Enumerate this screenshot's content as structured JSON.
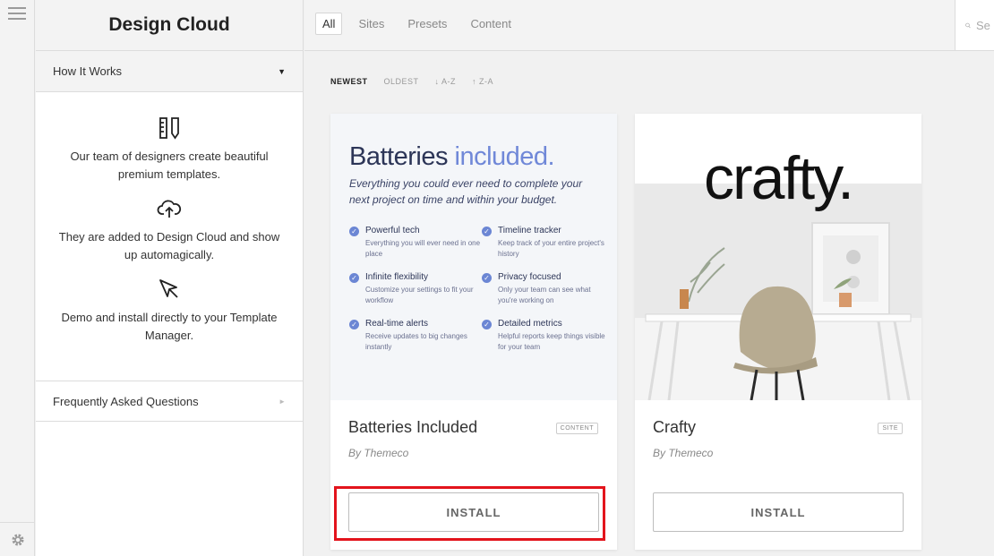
{
  "sidebar": {
    "title": "Design Cloud",
    "how_it_works": {
      "label": "How It Works",
      "steps": [
        {
          "icon": "ruler-pencil-icon",
          "text": "Our team of designers create beautiful premium templates."
        },
        {
          "icon": "cloud-upload-icon",
          "text": "They are added to Design Cloud and show up automagically."
        },
        {
          "icon": "cursor-arrow-icon",
          "text": "Demo and install directly to your Template Manager."
        }
      ]
    },
    "faq": {
      "label": "Frequently Asked Questions"
    }
  },
  "tabs": [
    "All",
    "Sites",
    "Presets",
    "Content"
  ],
  "active_tab": "All",
  "search": {
    "placeholder": "Se"
  },
  "sort": [
    "NEWEST",
    "OLDEST",
    "↓ A-Z",
    "↑ Z-A"
  ],
  "active_sort": "NEWEST",
  "cards": [
    {
      "name": "Batteries Included",
      "author": "By Themeco",
      "badge": "CONTENT",
      "install_label": "INSTALL",
      "preview": {
        "title_main": "Batteries",
        "title_highlight": "included.",
        "subtitle": "Everything you could ever need to complete your next project on time and within your budget.",
        "features": [
          {
            "title": "Powerful tech",
            "desc": "Everything you will ever need in one place"
          },
          {
            "title": "Timeline tracker",
            "desc": "Keep track of your entire project's history"
          },
          {
            "title": "Infinite flexibility",
            "desc": "Customize your settings to fit your workflow"
          },
          {
            "title": "Privacy focused",
            "desc": "Only your team can see what you're working on"
          },
          {
            "title": "Real-time alerts",
            "desc": "Receive updates to big changes instantly"
          },
          {
            "title": "Detailed metrics",
            "desc": "Helpful reports keep things visible for your team"
          }
        ]
      }
    },
    {
      "name": "Crafty",
      "author": "By Themeco",
      "badge": "SITE",
      "install_label": "INSTALL",
      "preview": {
        "wordmark": "crafty."
      }
    }
  ],
  "colors": {
    "highlight_border": "#e3141c",
    "accent_blue": "#7088d8"
  }
}
